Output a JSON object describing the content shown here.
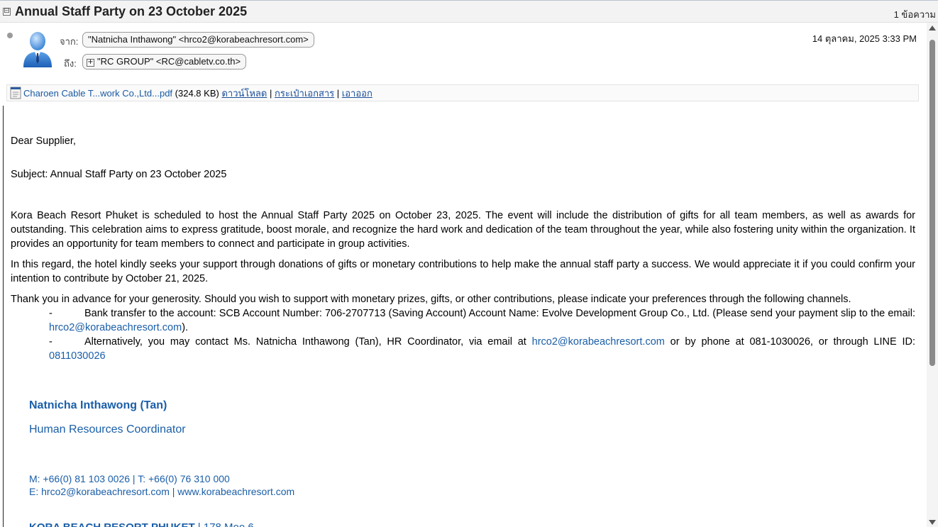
{
  "thread": {
    "collapse_glyph": "⊟",
    "title": "Annual Staff Party on 23 October 2025",
    "message_count": "1 ข้อความ"
  },
  "message": {
    "from_label": "จาก:",
    "from_value": "\"Natnicha Inthawong\" <hrco2@korabeachresort.com>",
    "to_label": "ถึง:",
    "to_value": "\"RC GROUP\" <RC@cabletv.co.th>",
    "to_expand_glyph": "+",
    "date": "14 ตุลาคม, 2025 3:33 PM"
  },
  "attachment": {
    "icon": "document-icon",
    "name": "Charoen Cable T...work Co.,Ltd...pdf",
    "size": "(324.8 KB)",
    "download": "ดาวน์โหลด",
    "briefcase": "กระเป๋าเอกสาร",
    "remove": "เอาออก",
    "separator": "|"
  },
  "body": {
    "greeting": "Dear Supplier,",
    "subject": "Subject: Annual Staff Party on 23 October 2025",
    "para1": "Kora Beach Resort Phuket is scheduled to host the Annual Staff Party 2025 on October 23, 2025. The event will include the distribution of gifts for all team members, as well as awards for outstanding. This celebration aims to express gratitude, boost morale, and recognize the hard work and dedication of the team throughout the year, while also fostering unity within the organization. It provides an opportunity for team members to connect and participate in group activities.",
    "para2": "In this regard, the hotel kindly seeks your support through donations of gifts or monetary contributions to help make the annual staff party a success. We would appreciate it if you could confirm your intention to contribute by October 21, 2025.",
    "para3": "Thank you in advance for your generosity. Should you wish to support with monetary prizes, gifts, or other contributions, please indicate your preferences through the following channels.",
    "bullet_dash": "-",
    "bullet1_text": "Bank transfer to the account: SCB Account Number: 706-2707713 (Saving Account) Account Name:  Evolve Development Group Co., Ltd. (Please send your payment slip to the email: ",
    "bullet1_email": "hrco2@korabeachresort.com",
    "bullet1_end": ").",
    "bullet2_text": "Alternatively, you may contact Ms. Natnicha Inthawong (Tan), HR Coordinator, via email at ",
    "bullet2_email": "hrco2@korabeachresort.com",
    "bullet2_mid": " or by phone at 081-1030026, or through LINE ID: ",
    "bullet2_line": "0811030026"
  },
  "signature": {
    "name": "Natnicha Inthawong (Tan)",
    "role": "Human Resources Coordinator",
    "phones": "M: +66(0) 81 103 0026 | T: +66(0) 76 310 000",
    "email_web": "E: hrco2@korabeachresort.com | www.korabeachresort.com",
    "resort_name": "KORA BEACH RESORT PHUKET",
    "resort_addr": " | 178 Moo 6"
  }
}
